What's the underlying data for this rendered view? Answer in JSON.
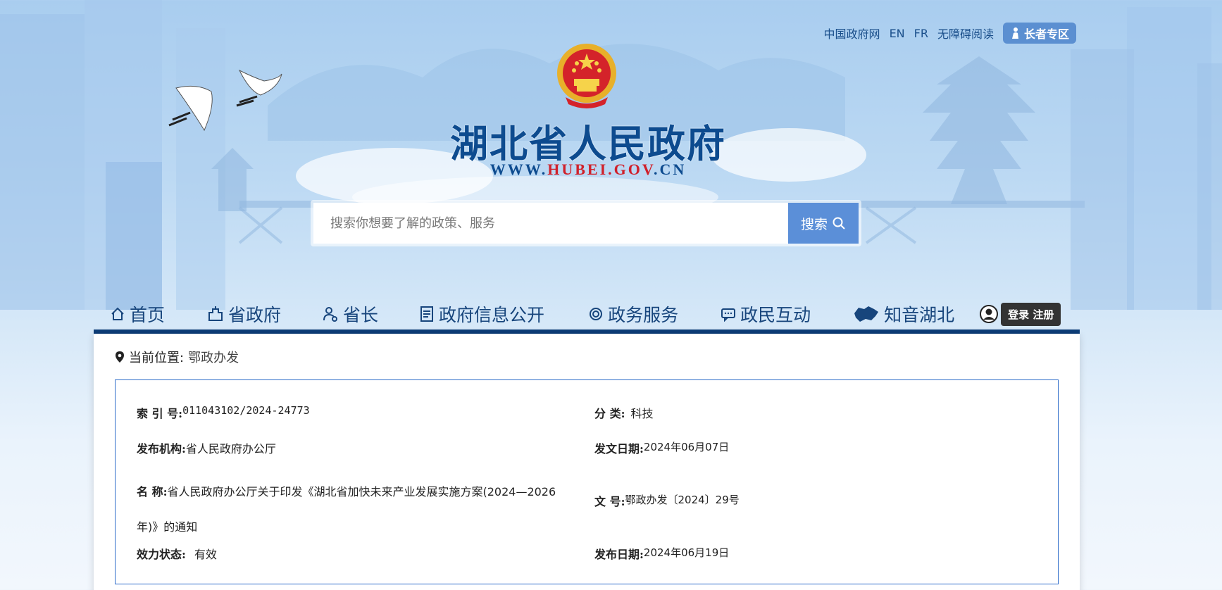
{
  "toplinks": {
    "items": [
      "中国政府网",
      "EN",
      "FR",
      "无障碍阅读"
    ],
    "elder_label": "长者专区"
  },
  "header": {
    "title": "湖北省人民政府",
    "url_prefix": "WWW.",
    "url_mid": "HUBEI.GOV",
    "url_suffix": ".CN"
  },
  "search": {
    "placeholder": "搜索你想要了解的政策、服务",
    "button_label": "搜索"
  },
  "nav": {
    "items": [
      {
        "label": "首页",
        "icon": "home-icon"
      },
      {
        "label": "省政府",
        "icon": "building-icon"
      },
      {
        "label": "省长",
        "icon": "person-icon"
      },
      {
        "label": "政府信息公开",
        "icon": "document-icon"
      },
      {
        "label": "政务服务",
        "icon": "service-icon"
      },
      {
        "label": "政民互动",
        "icon": "chat-icon"
      },
      {
        "label": "知音湖北",
        "icon": "hubei-map-icon"
      }
    ],
    "login_label": "登录 注册"
  },
  "breadcrumb": {
    "label": "当前位置:",
    "current": "鄂政办发"
  },
  "meta": {
    "index_key": "索 引 号:",
    "index_val": "011043102/2024-24773",
    "category_key": "分 类:",
    "category_val": "科技",
    "publisher_key": "发布机构:",
    "publisher_val": "省人民政府办公厅",
    "issue_date_key": "发文日期:",
    "issue_date_val": "2024年06月07日",
    "name_key": "名 称:",
    "name_val": "省人民政府办公厅关于印发《湖北省加快未来产业发展实施方案(2024—2026年)》的通知",
    "doc_no_key": "文 号:",
    "doc_no_val": "鄂政办发〔2024〕29号",
    "status_key": "效力状态:",
    "status_val": "有效",
    "release_date_key": "发布日期:",
    "release_date_val": "2024年06月19日"
  }
}
